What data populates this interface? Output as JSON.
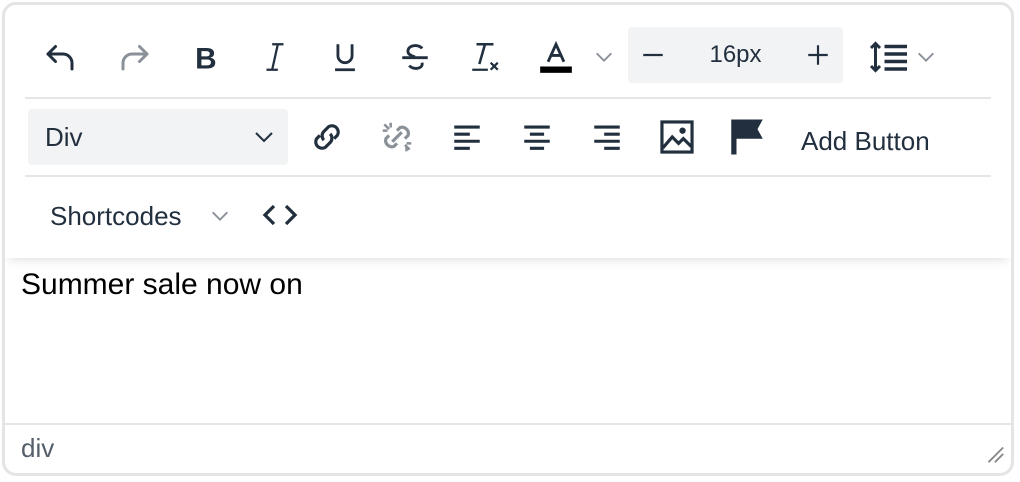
{
  "toolbar": {
    "font_size": "16px",
    "block_format": "Div",
    "add_button_label": "Add Button",
    "shortcodes_label": "Shortcodes"
  },
  "content": {
    "text": "Summer sale now on"
  },
  "status": {
    "path": "div"
  },
  "colors": {
    "icon": "#222f3e",
    "disabled_icon": "#8a9199",
    "text_color_bar": "#000000",
    "border": "#e4e4e4",
    "field_bg": "#f2f3f4"
  },
  "icons": [
    "undo-icon",
    "redo-icon",
    "bold-icon",
    "italic-icon",
    "underline-icon",
    "strikethrough-icon",
    "clear-formatting-icon",
    "text-color-icon",
    "chevron-down-icon",
    "minus-icon",
    "plus-icon",
    "line-height-icon",
    "link-icon",
    "unlink-icon",
    "align-left-icon",
    "align-center-icon",
    "align-right-icon",
    "image-icon",
    "flag-icon",
    "code-icon",
    "resize-handle-icon"
  ]
}
